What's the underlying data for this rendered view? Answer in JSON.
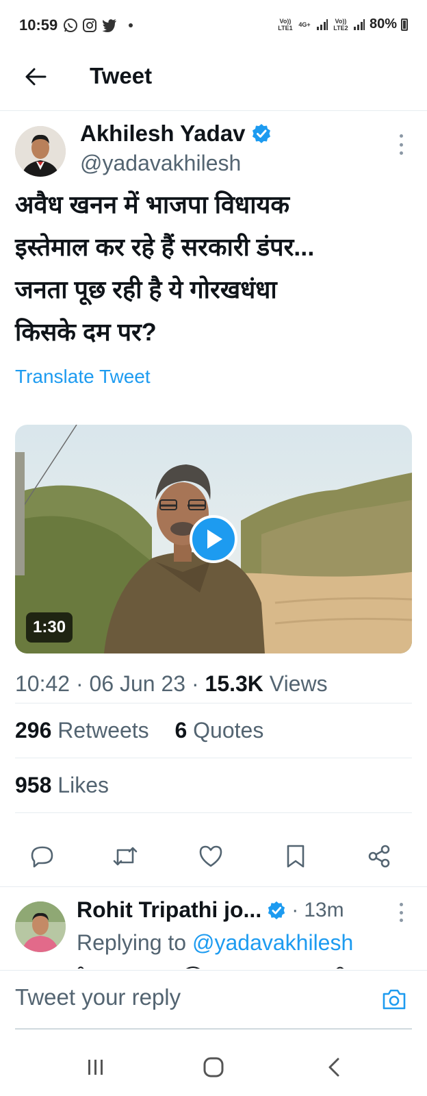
{
  "status_bar": {
    "time": "10:59",
    "network_1": "Vo)) LTE1",
    "network_type": "4G+",
    "network_2": "Vo)) LTE2",
    "battery": "80%"
  },
  "header": {
    "title": "Tweet"
  },
  "tweet": {
    "author_name": "Akhilesh Yadav",
    "author_handle": "@yadavakhilesh",
    "text_lines": [
      "अवैध खनन में भाजपा विधायक",
      "इस्तेमाल कर रहे हैं सरकारी डंपर...",
      "जनता पूछ रही है ये गोरखधंधा",
      "किसके दम पर?"
    ],
    "translate_label": "Translate Tweet",
    "video_duration": "1:30",
    "time": "10:42",
    "date": "06 Jun 23",
    "views_count": "15.3K",
    "views_label": "Views",
    "retweets_count": "296",
    "retweets_label": "Retweets",
    "quotes_count": "6",
    "quotes_label": "Quotes",
    "likes_count": "958",
    "likes_label": "Likes"
  },
  "reply": {
    "author_name": "Rohit Tripathi jo...",
    "time": "13m",
    "replying_label": "Replying to",
    "replying_handle": "@yadavakhilesh"
  },
  "compose": {
    "placeholder": "Tweet your reply"
  },
  "colors": {
    "accent": "#1d9bf0",
    "secondary_text": "#536471",
    "divider": "#e6ecf0"
  }
}
